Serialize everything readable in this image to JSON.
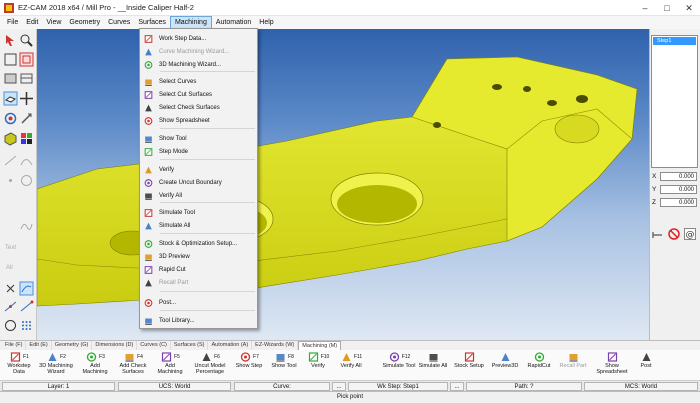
{
  "window": {
    "title": "EZ-CAM 2018 x64 / Mill Pro - __Inside Caliper Half-2"
  },
  "menubar": [
    "File",
    "Edit",
    "View",
    "Geometry",
    "Curves",
    "Surfaces",
    "Machining",
    "Automation",
    "Help"
  ],
  "machining_menu": [
    {
      "label": "Work Step Data...",
      "enabled": true,
      "icon": "work-step-data-icon"
    },
    {
      "label": "Curve Machining Wizard...",
      "enabled": false,
      "icon": "curve-wizard-icon"
    },
    {
      "label": "3D Machining Wizard...",
      "enabled": true,
      "icon": "3d-wizard-icon"
    },
    {
      "label": "Select Curves",
      "enabled": true,
      "icon": "select-curves-icon"
    },
    {
      "label": "Select Cut Surfaces",
      "enabled": true,
      "icon": "select-cut-surfaces-icon"
    },
    {
      "label": "Select Check Surfaces",
      "enabled": true,
      "icon": "select-check-surfaces-icon"
    },
    {
      "label": "Show Spreadsheet",
      "enabled": true,
      "icon": "spreadsheet-icon"
    },
    {
      "label": "Show Tool",
      "enabled": true,
      "icon": "show-tool-icon"
    },
    {
      "label": "Step Mode",
      "enabled": true,
      "icon": "step-mode-icon"
    },
    {
      "label": "Verify",
      "enabled": true,
      "icon": "verify-icon"
    },
    {
      "label": "Create Uncut Boundary",
      "enabled": true,
      "icon": "uncut-boundary-icon"
    },
    {
      "label": "Verify All",
      "enabled": true,
      "icon": "verify-all-icon"
    },
    {
      "label": "Simulate Tool",
      "enabled": true,
      "icon": "simulate-tool-icon"
    },
    {
      "label": "Simulate All",
      "enabled": true,
      "icon": "simulate-all-icon"
    },
    {
      "label": "Stock & Optimization Setup...",
      "enabled": true,
      "icon": "stock-setup-icon"
    },
    {
      "label": "3D Preview",
      "enabled": true,
      "icon": "3d-preview-icon"
    },
    {
      "label": "Rapid Cut",
      "enabled": true,
      "icon": "rapid-cut-icon"
    },
    {
      "label": "Recall Part",
      "enabled": false,
      "icon": "recall-part-icon"
    },
    {
      "label": "Post...",
      "enabled": true,
      "icon": "post-icon"
    },
    {
      "label": "Tool Library...",
      "enabled": true,
      "icon": "tool-library-icon"
    }
  ],
  "step_list": [
    "Step1"
  ],
  "coords": [
    {
      "axis": "X",
      "value": "0.000"
    },
    {
      "axis": "Y",
      "value": "0.000"
    },
    {
      "axis": "Z",
      "value": "0.000"
    }
  ],
  "left_toolbar_text": {
    "text": "Text",
    "all": "All"
  },
  "tabs": [
    "File (F)",
    "Edit (E)",
    "Geometry (G)",
    "Dimensions (D)",
    "Curves (C)",
    "Surfaces (S)",
    "Automation (A)",
    "EZ-Wizards (W)",
    "Machining (M)"
  ],
  "active_tab": "Machining (M)",
  "ribbon": [
    {
      "key": "F1",
      "label": "Workstep\nData",
      "enabled": true
    },
    {
      "key": "F2",
      "label": "3D Machining\nWizard",
      "enabled": true
    },
    {
      "key": "F3",
      "label": "Add\nMachining",
      "enabled": true
    },
    {
      "key": "F4",
      "label": "Add Check\nSurfaces",
      "enabled": true
    },
    {
      "key": "F5",
      "label": "Add\nMachining",
      "enabled": true
    },
    {
      "key": "F6",
      "label": "Uncut Model\nPercentage",
      "enabled": true
    },
    {
      "key": "F7",
      "label": "Show Step",
      "enabled": true
    },
    {
      "key": "F8",
      "label": "Show Tool",
      "enabled": true
    },
    {
      "key": "F10",
      "label": "Verify",
      "enabled": true
    },
    {
      "key": "F11",
      "label": "Verify All",
      "enabled": true
    },
    {
      "key": "F12",
      "label": "Simulate Tool",
      "enabled": true
    },
    {
      "key": "",
      "label": "Simulate All",
      "enabled": true
    },
    {
      "key": "",
      "label": "Stock Setup",
      "enabled": true
    },
    {
      "key": "",
      "label": "Preview3D",
      "enabled": true
    },
    {
      "key": "",
      "label": "RapidCut",
      "enabled": true
    },
    {
      "key": "",
      "label": "Recall Part",
      "enabled": false
    },
    {
      "key": "",
      "label": "Show\nSpreadsheet",
      "enabled": true
    },
    {
      "key": "",
      "label": "Post",
      "enabled": true
    }
  ],
  "status": {
    "layer": "Layer: 1",
    "ucs": "UCS: World",
    "curve": "Curve:",
    "ellipsis1": "...",
    "wkstep": "Wk Step: Step1",
    "ellipsis2": "...",
    "path": "Path:  ?",
    "mcs": "MCS: World"
  },
  "prompt": "Pick point",
  "colors": {
    "part_yellow": "#e4e61a",
    "menu_highlight": "#cce4f7",
    "step_selected": "#3399ff"
  }
}
